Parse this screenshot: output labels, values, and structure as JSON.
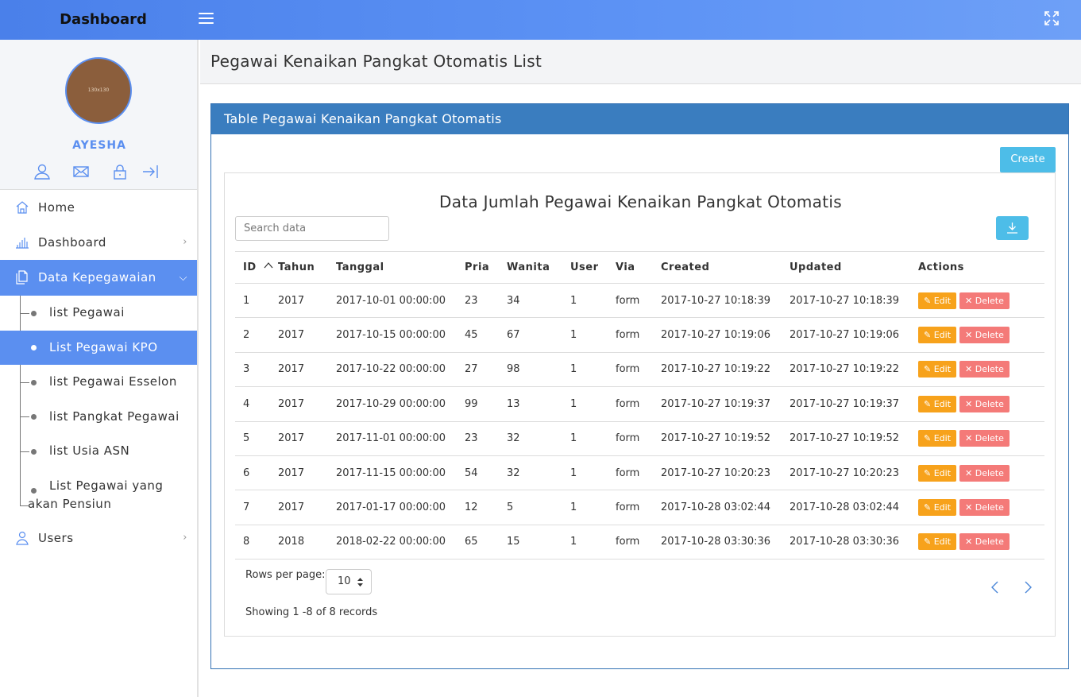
{
  "topbar": {
    "brand": "Dashboard"
  },
  "profile": {
    "avatar_text": "130x130",
    "name": "AYESHA"
  },
  "menu": {
    "home": "Home",
    "dashboard": "Dashboard",
    "data_kepegawaian": "Data Kepegawaian",
    "submenu": [
      "list Pegawai",
      "List Pegawai KPO",
      "list Pegawai Esselon",
      "list Pangkat Pegawai",
      "list Usia ASN",
      "List Pegawai yang akan Pensiun"
    ],
    "users": "Users"
  },
  "page": {
    "title": "Pegawai Kenaikan Pangkat Otomatis List",
    "card_title": "Table Pegawai Kenaikan Pangkat Otomatis",
    "create_label": "Create",
    "table_title": "Data Jumlah Pegawai Kenaikan Pangkat Otomatis",
    "search_placeholder": "Search data"
  },
  "table": {
    "headers": [
      "ID",
      "Tahun",
      "Tanggal",
      "Pria",
      "Wanita",
      "User",
      "Via",
      "Created",
      "Updated",
      "Actions"
    ],
    "edit_label": "Edit",
    "delete_label": "Delete",
    "rows": [
      [
        "1",
        "2017",
        "2017-10-01 00:00:00",
        "23",
        "34",
        "1",
        "form",
        "2017-10-27 10:18:39",
        "2017-10-27 10:18:39"
      ],
      [
        "2",
        "2017",
        "2017-10-15 00:00:00",
        "45",
        "67",
        "1",
        "form",
        "2017-10-27 10:19:06",
        "2017-10-27 10:19:06"
      ],
      [
        "3",
        "2017",
        "2017-10-22 00:00:00",
        "27",
        "98",
        "1",
        "form",
        "2017-10-27 10:19:22",
        "2017-10-27 10:19:22"
      ],
      [
        "4",
        "2017",
        "2017-10-29 00:00:00",
        "99",
        "13",
        "1",
        "form",
        "2017-10-27 10:19:37",
        "2017-10-27 10:19:37"
      ],
      [
        "5",
        "2017",
        "2017-11-01 00:00:00",
        "23",
        "32",
        "1",
        "form",
        "2017-10-27 10:19:52",
        "2017-10-27 10:19:52"
      ],
      [
        "6",
        "2017",
        "2017-11-15 00:00:00",
        "54",
        "32",
        "1",
        "form",
        "2017-10-27 10:20:23",
        "2017-10-27 10:20:23"
      ],
      [
        "7",
        "2017",
        "2017-01-17 00:00:00",
        "12",
        "5",
        "1",
        "form",
        "2017-10-28 03:02:44",
        "2017-10-28 03:02:44"
      ],
      [
        "8",
        "2018",
        "2018-02-22 00:00:00",
        "65",
        "15",
        "1",
        "form",
        "2017-10-28 03:30:36",
        "2017-10-28 03:30:36"
      ]
    ]
  },
  "footer": {
    "rows_per_page_label": "Rows per page:",
    "rows_per_page_value": "10",
    "showing": "Showing 1 -8 of 8 records"
  }
}
